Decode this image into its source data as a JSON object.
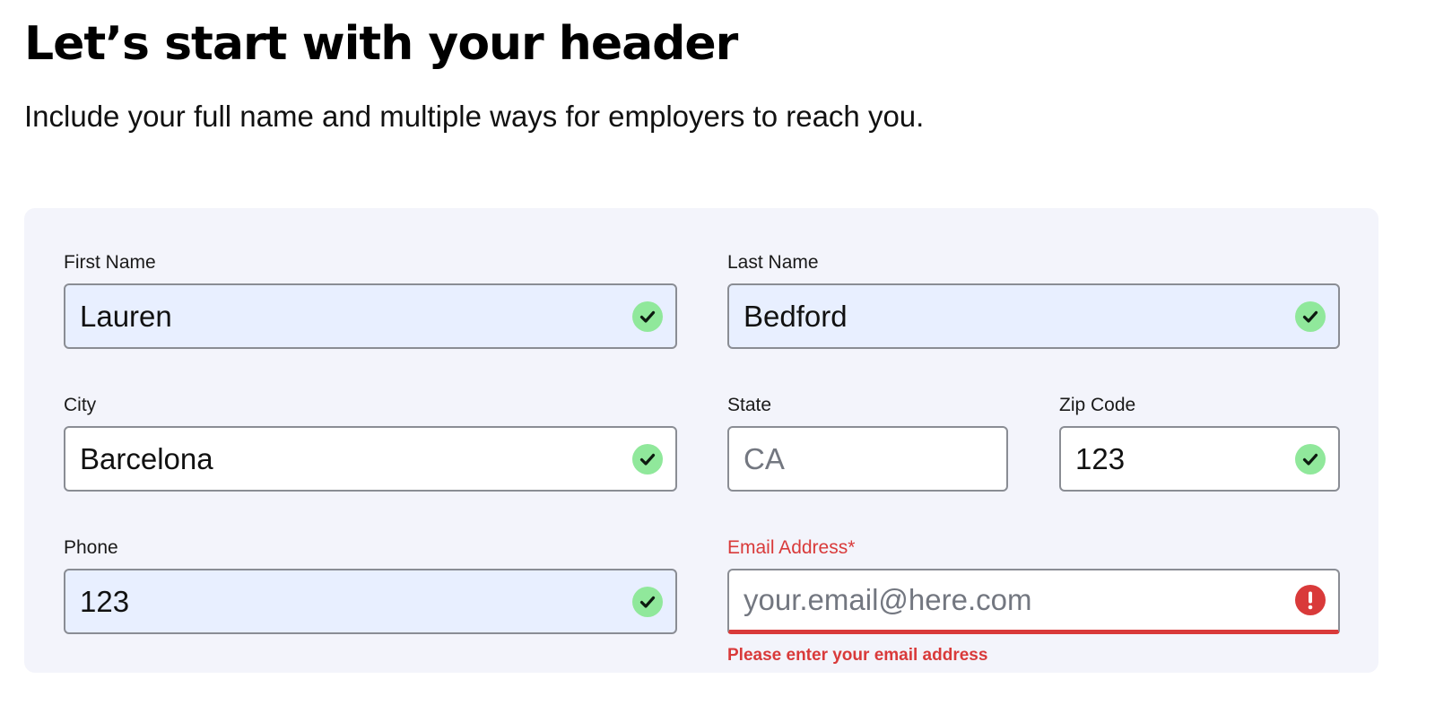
{
  "header": {
    "title": "Let’s start with your header",
    "subtitle": "Include your full name and multiple ways for employers to reach you."
  },
  "form": {
    "first_name": {
      "label": "First Name",
      "value": "Lauren",
      "placeholder": "",
      "status": "valid"
    },
    "last_name": {
      "label": "Last Name",
      "value": "Bedford",
      "placeholder": "",
      "status": "valid"
    },
    "city": {
      "label": "City",
      "value": "Barcelona",
      "placeholder": "",
      "status": "valid"
    },
    "state": {
      "label": "State",
      "value": "",
      "placeholder": "CA",
      "status": "none"
    },
    "zip": {
      "label": "Zip Code",
      "value": "123",
      "placeholder": "",
      "status": "valid"
    },
    "phone": {
      "label": "Phone",
      "value": "123",
      "placeholder": "",
      "status": "valid"
    },
    "email": {
      "label": "Email Address*",
      "value": "",
      "placeholder": "your.email@here.com",
      "status": "error",
      "error_message": "Please enter your email address"
    }
  },
  "icons": {
    "valid": "check-circle-icon",
    "error": "exclamation-circle-icon"
  },
  "colors": {
    "card_background": "#f3f4fb",
    "filled_input": "#e8efff",
    "valid_green": "#90e89b",
    "error_red": "#d93a3a",
    "input_border": "#8a8d94"
  }
}
